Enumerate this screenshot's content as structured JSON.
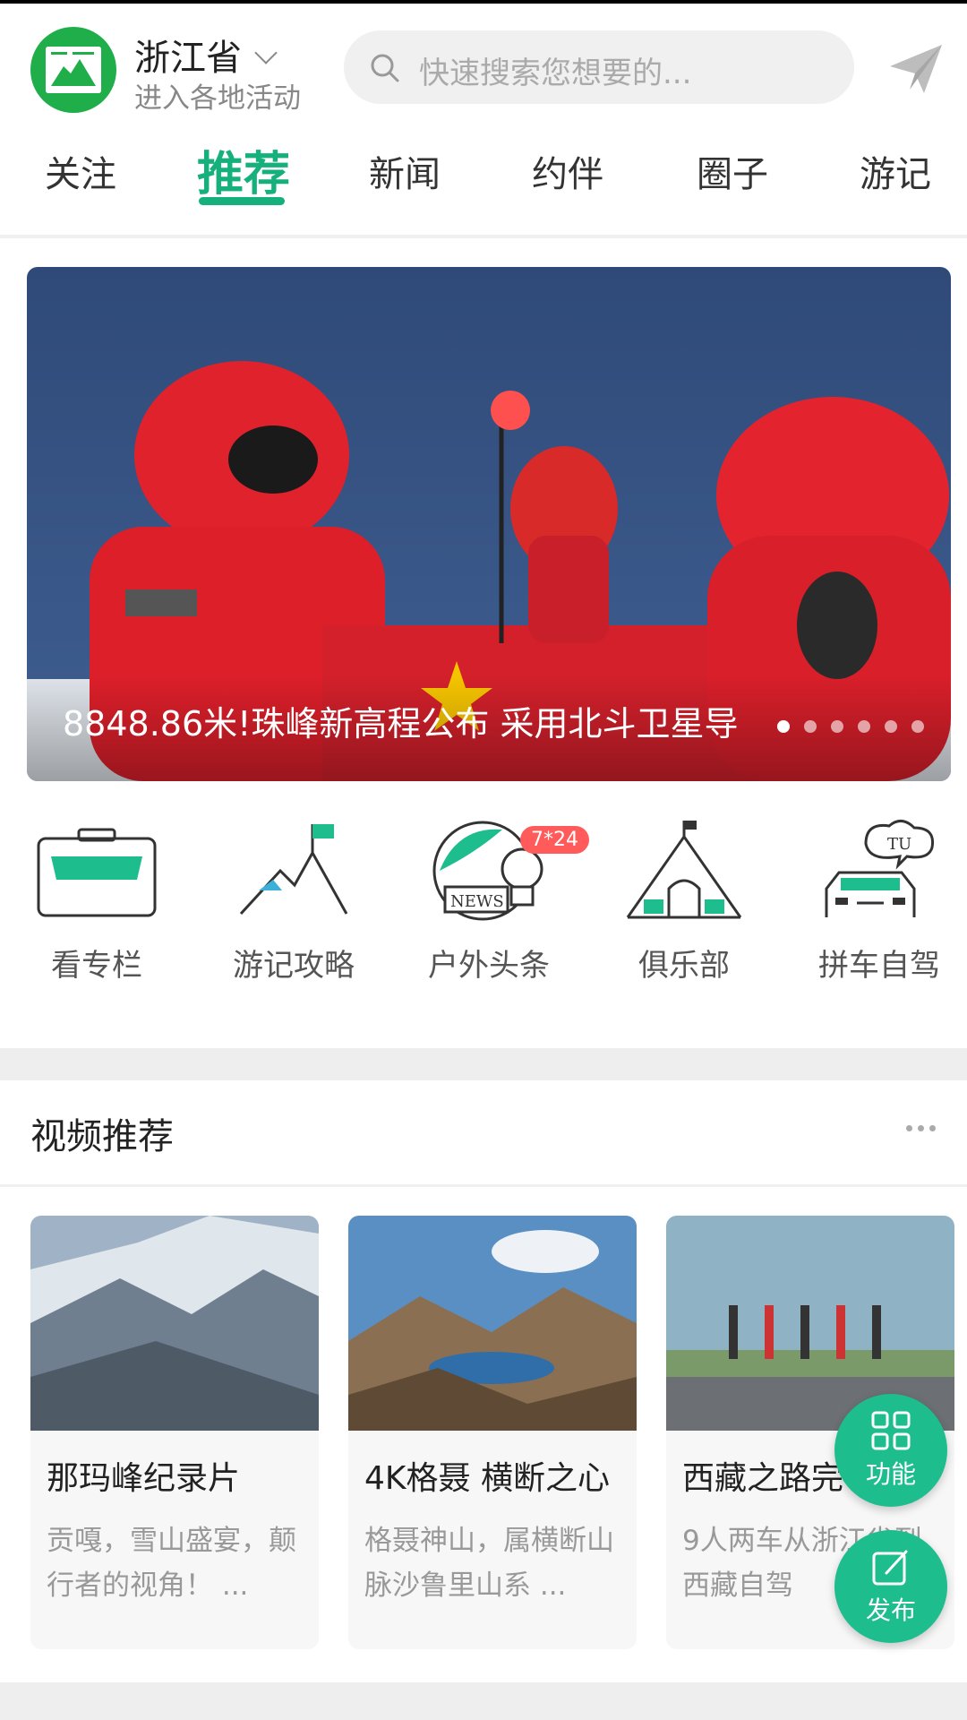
{
  "header": {
    "location": "浙江省",
    "location_sub": "进入各地活动",
    "search_placeholder": "快速搜索您想要的..."
  },
  "tabs": [
    {
      "label": "关注",
      "active": false
    },
    {
      "label": "推荐",
      "active": true
    },
    {
      "label": "新闻",
      "active": false
    },
    {
      "label": "约伴",
      "active": false
    },
    {
      "label": "圈子",
      "active": false
    },
    {
      "label": "游记",
      "active": false
    }
  ],
  "banner": {
    "caption": "8848.86米!珠峰新高程公布 采用北斗卫星导",
    "slide_count": 6,
    "active_slide": 1
  },
  "quick_links": [
    {
      "label": "看专栏",
      "icon": "column-briefcase-icon"
    },
    {
      "label": "游记攻略",
      "icon": "mountain-flag-icon"
    },
    {
      "label": "户外头条",
      "icon": "news-icon",
      "badge": "7*24"
    },
    {
      "label": "俱乐部",
      "icon": "tent-icon"
    },
    {
      "label": "拼车自驾",
      "icon": "car-icon"
    }
  ],
  "video_section": {
    "title": "视频推荐",
    "cards": [
      {
        "title": "那玛峰纪录片",
        "desc": "贡嘎，雪山盛宴，颠行者的视角！ ..."
      },
      {
        "title": "4K格聂 横断之心",
        "desc": "格聂神山，属横断山脉沙鲁里山系 ..."
      },
      {
        "title": "西藏之路完",
        "desc": "9人两车从浙江省到西藏自驾"
      }
    ]
  },
  "fabs": {
    "function_label": "功能",
    "publish_label": "发布"
  },
  "colors": {
    "accent": "#16b07d",
    "fab": "#1ebd8e",
    "badge": "#ff5b5b"
  }
}
